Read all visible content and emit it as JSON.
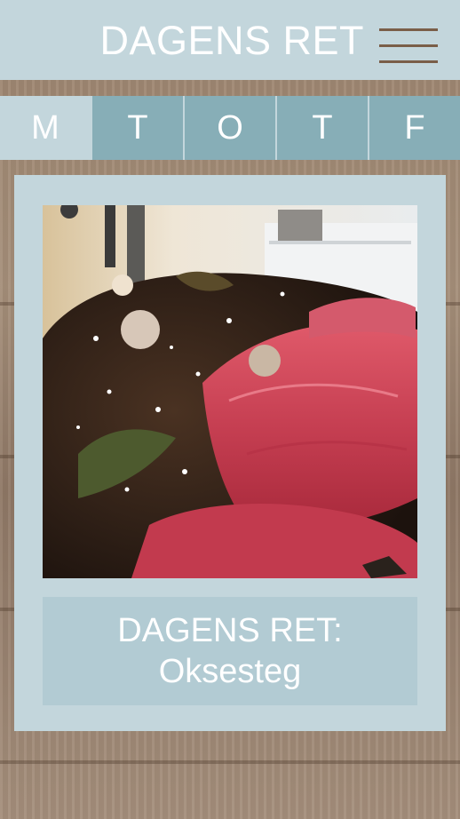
{
  "header": {
    "title": "DAGENS RET",
    "menu_icon": "hamburger-menu-icon"
  },
  "days": [
    {
      "label": "M",
      "selected": true
    },
    {
      "label": "T",
      "selected": false
    },
    {
      "label": "O",
      "selected": false
    },
    {
      "label": "T",
      "selected": false
    },
    {
      "label": "F",
      "selected": false
    }
  ],
  "dish": {
    "caption_title": "DAGENS RET:",
    "name": "Oksesteg"
  },
  "colors": {
    "header_bg": "#c3d6dc",
    "day_active": "#c3d6dc",
    "day_inactive": "#87aeb7",
    "caption_bg": "#b2cbd3",
    "menu_lines": "#7a5e48"
  }
}
